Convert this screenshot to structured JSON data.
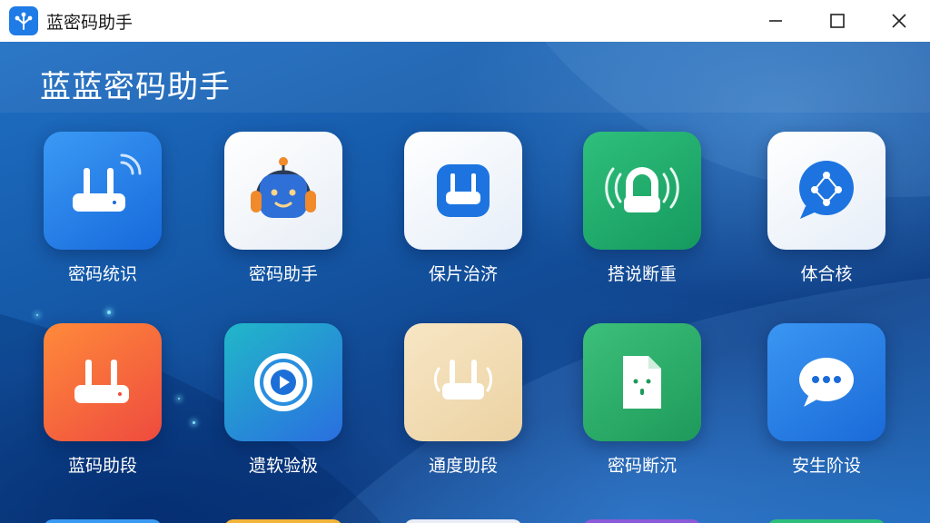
{
  "titlebar": {
    "app_icon": "app-logo-icon",
    "title": "蓝密码助手",
    "controls": {
      "minimize": "minimize-icon",
      "maximize": "maximize-icon",
      "close": "close-icon"
    }
  },
  "header": {
    "title": "蓝蓝密码助手"
  },
  "colors": {
    "titlebar_bg": "#ffffff",
    "background": "#1559a8",
    "accent": "#1f7be6"
  },
  "tiles": [
    {
      "label": "密码统识",
      "icon": "router-icon"
    },
    {
      "label": "密码助手",
      "icon": "robot-headphones-icon"
    },
    {
      "label": "保片治济",
      "icon": "router-icon"
    },
    {
      "label": "搭说断重",
      "icon": "wifi-camera-icon"
    },
    {
      "label": "体合核",
      "icon": "network-chat-icon"
    },
    {
      "label": "蓝码助段",
      "icon": "router-icon"
    },
    {
      "label": "遗软验极",
      "icon": "play-icon"
    },
    {
      "label": "通度助段",
      "icon": "router-icon"
    },
    {
      "label": "密码断沉",
      "icon": "document-icon"
    },
    {
      "label": "安生阶设",
      "icon": "chat-bubble-icon"
    }
  ]
}
